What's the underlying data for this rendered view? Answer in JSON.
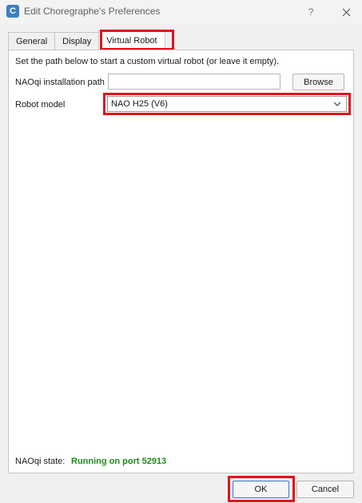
{
  "window": {
    "title": "Edit Choregraphe's Preferences",
    "app_icon_letter": "C",
    "help_label": "?"
  },
  "tabs": [
    {
      "label": "General"
    },
    {
      "label": "Display"
    },
    {
      "label": "Virtual Robot",
      "active": true
    }
  ],
  "virtual_robot": {
    "description": "Set the path below to start a custom virtual robot (or leave it empty).",
    "naoqi_path_label": "NAOqi installation path",
    "naoqi_path_value": "",
    "browse_label": "Browse",
    "robot_model_label": "Robot model",
    "robot_model_value": "NAO H25 (V6)",
    "naoqi_state_label": "NAOqi state:",
    "naoqi_state_value": "Running on port 52913"
  },
  "buttons": {
    "ok_label": "OK",
    "cancel_label": "Cancel"
  },
  "colors": {
    "highlight": "#e0131a",
    "status_ok": "#1c8a1c",
    "app_icon": "#3d7fc1"
  }
}
